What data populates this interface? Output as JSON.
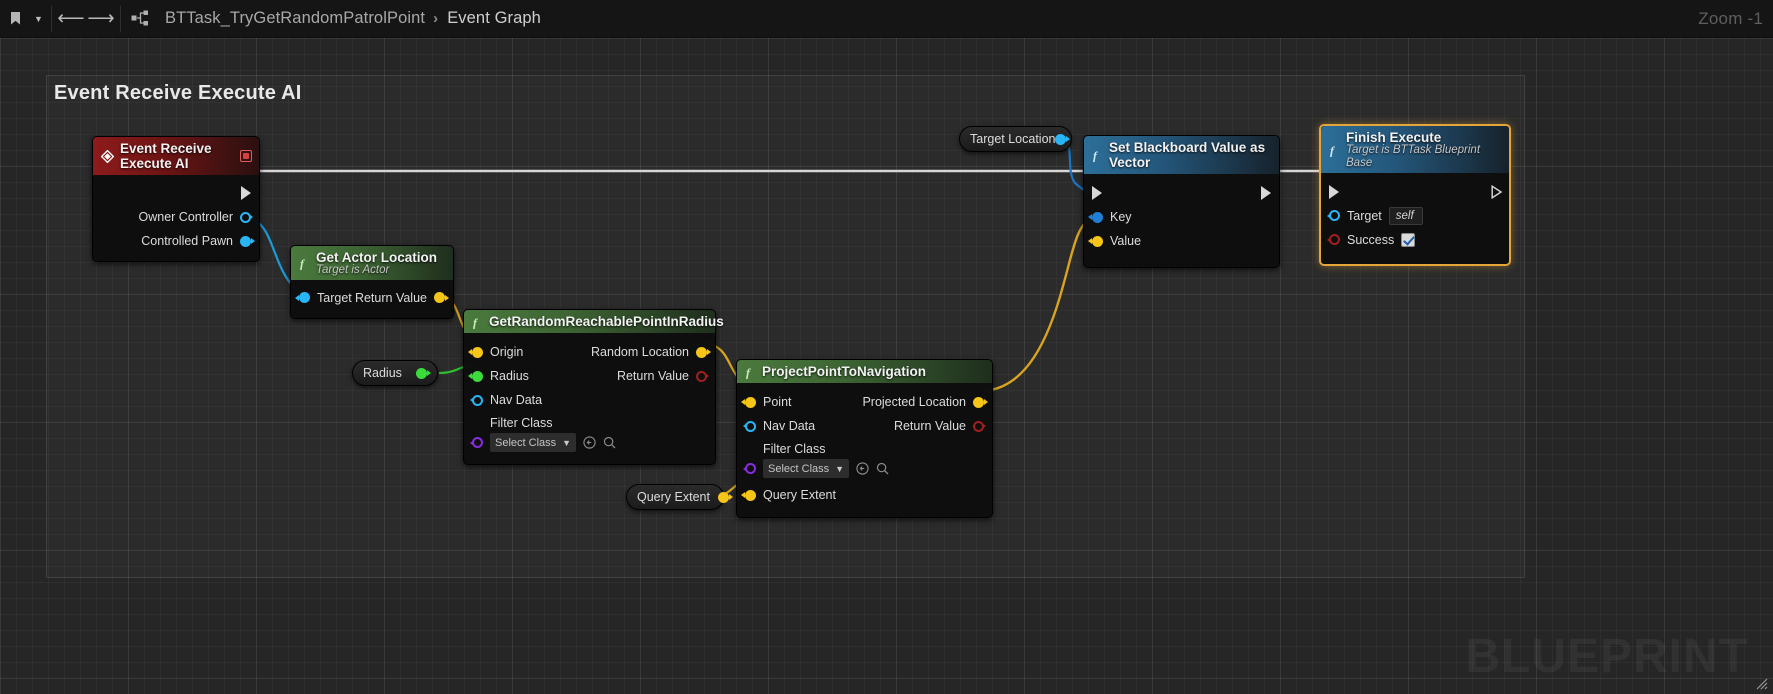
{
  "toolbar": {
    "bookmark_icon": "bookmark-icon",
    "dropdown_icon": "chevron-down-icon",
    "back_icon": "back-arrow-icon",
    "forward_icon": "forward-arrow-icon",
    "graph_icon": "blueprint-graph-icon",
    "breadcrumb": {
      "blueprint": "BTTask_TryGetRandomPatrolPoint",
      "separator": "›",
      "graph": "Event Graph"
    },
    "zoom_label": "Zoom -1"
  },
  "comment": {
    "title": "Event Receive Execute AI",
    "watermark": "BLUEPRINT",
    "resize_icon": "resize-handle-icon"
  },
  "nodes": {
    "event_receive": {
      "title": "Event Receive Execute AI",
      "icon": "event-diamond-icon",
      "delegate_icon": "event-square-icon",
      "exec_out": "",
      "pins_out": [
        {
          "label": "Owner Controller",
          "type": "object",
          "color": "#29b6f6",
          "hollow": false
        },
        {
          "label": "Controlled Pawn",
          "type": "object",
          "color": "#29b6f6",
          "hollow": false
        }
      ]
    },
    "get_actor_location": {
      "title": "Get Actor Location",
      "subtitle": "Target is Actor",
      "icon": "function-f-icon",
      "pin_in": {
        "label": "Target",
        "type": "object",
        "color": "#29b6f6",
        "hollow": false
      },
      "pin_out": {
        "label": "Return Value",
        "type": "vector",
        "color": "#f5c518",
        "hollow": false
      }
    },
    "radius_knot": {
      "label": "Radius",
      "color": "#3cdb3c"
    },
    "get_random_reachable": {
      "title": "GetRandomReachablePointInRadius",
      "icon": "function-f-icon",
      "pins_in": [
        {
          "label": "Origin",
          "type": "vector",
          "color": "#f5c518",
          "hollow": false
        },
        {
          "label": "Radius",
          "type": "float",
          "color": "#3cdb3c",
          "hollow": false
        },
        {
          "label": "Nav Data",
          "type": "object",
          "color": "#29b6f6",
          "hollow": true
        }
      ],
      "pins_out": [
        {
          "label": "Random Location",
          "type": "vector",
          "color": "#f5c518",
          "hollow": false
        },
        {
          "label": "Return Value",
          "type": "bool",
          "color": "#a01f1f",
          "hollow": true
        }
      ],
      "filter_class": {
        "label": "Filter Class",
        "pin_color": "#8a2be2",
        "select_value": "Select Class",
        "chevron_icon": "chevron-down-icon",
        "browse_icon": "browse-back-icon",
        "search_icon": "search-icon"
      }
    },
    "project_point": {
      "title": "ProjectPointToNavigation",
      "icon": "function-f-icon",
      "pins_in": [
        {
          "label": "Point",
          "type": "vector",
          "color": "#f5c518",
          "hollow": false
        },
        {
          "label": "Nav Data",
          "type": "object",
          "color": "#29b6f6",
          "hollow": true
        }
      ],
      "pins_out": [
        {
          "label": "Projected Location",
          "type": "vector",
          "color": "#f5c518",
          "hollow": false
        },
        {
          "label": "Return Value",
          "type": "bool",
          "color": "#a01f1f",
          "hollow": true
        }
      ],
      "filter_class": {
        "label": "Filter Class",
        "pin_color": "#8a2be2",
        "select_value": "Select Class",
        "chevron_icon": "chevron-down-icon",
        "browse_icon": "browse-back-icon",
        "search_icon": "search-icon"
      },
      "query_extent": {
        "label": "Query Extent",
        "type": "vector",
        "color": "#f5c518"
      }
    },
    "query_extent_knot": {
      "label": "Query Extent",
      "color": "#f5c518"
    },
    "target_location_knot": {
      "label": "Target Location",
      "color": "#29b6f6"
    },
    "set_blackboard": {
      "title": "Set Blackboard Value as Vector",
      "icon": "function-f-icon",
      "pins_in": [
        {
          "label": "Key",
          "type": "struct",
          "color": "#1e7fd4",
          "hollow": false
        },
        {
          "label": "Value",
          "type": "vector",
          "color": "#f5c518",
          "hollow": false
        }
      ]
    },
    "finish_execute": {
      "title": "Finish Execute",
      "subtitle": "Target is BTTask Blueprint Base",
      "icon": "function-f-icon",
      "pins_in": [
        {
          "label": "Target",
          "type": "object",
          "color": "#29b6f6",
          "hollow": true,
          "value": "self"
        },
        {
          "label": "Success",
          "type": "bool",
          "color": "#a01f1f",
          "hollow": true,
          "checked": true
        }
      ]
    }
  }
}
